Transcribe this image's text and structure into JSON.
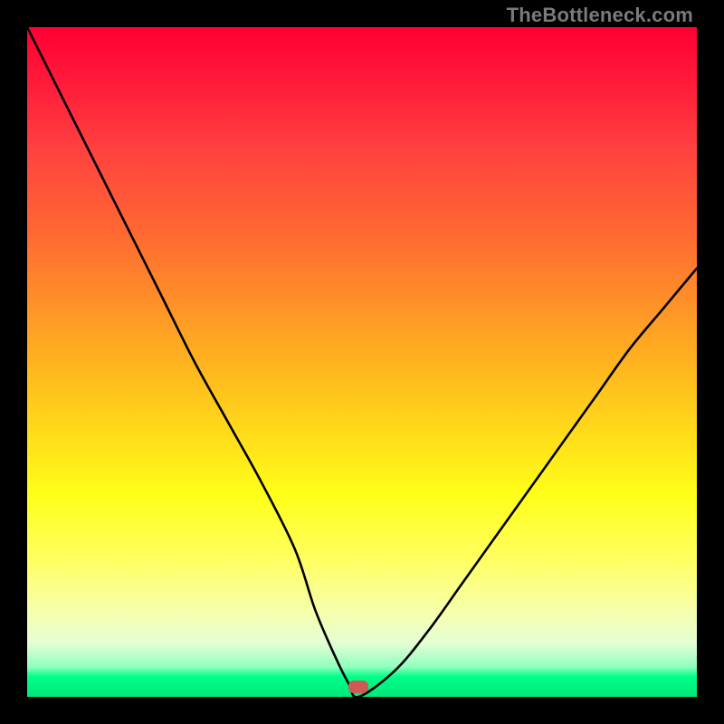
{
  "watermark": "TheBottleneck.com",
  "colors": {
    "frame": "#000000",
    "curve": "#000000",
    "marker": "#cc5a55"
  },
  "chart_data": {
    "type": "line",
    "title": "",
    "xlabel": "",
    "ylabel": "",
    "xlim": [
      0,
      100
    ],
    "ylim": [
      0,
      100
    ],
    "grid": false,
    "legend": false,
    "series": [
      {
        "name": "bottleneck-curve",
        "x": [
          0,
          5,
          10,
          15,
          20,
          25,
          30,
          35,
          40,
          43,
          46,
          48,
          49.5,
          55,
          60,
          65,
          70,
          75,
          80,
          85,
          90,
          95,
          100
        ],
        "y": [
          100,
          90,
          80,
          70,
          60,
          50,
          41,
          32,
          22,
          13,
          6,
          2,
          0,
          4,
          10,
          17,
          24,
          31,
          38,
          45,
          52,
          58,
          64
        ]
      }
    ],
    "annotations": [
      {
        "name": "optimum-marker",
        "x": 49.5,
        "y": 1.5
      }
    ],
    "background_gradient": {
      "top": "#ff0033",
      "mid": "#ffff1a",
      "bottom": "#00e67a"
    }
  }
}
